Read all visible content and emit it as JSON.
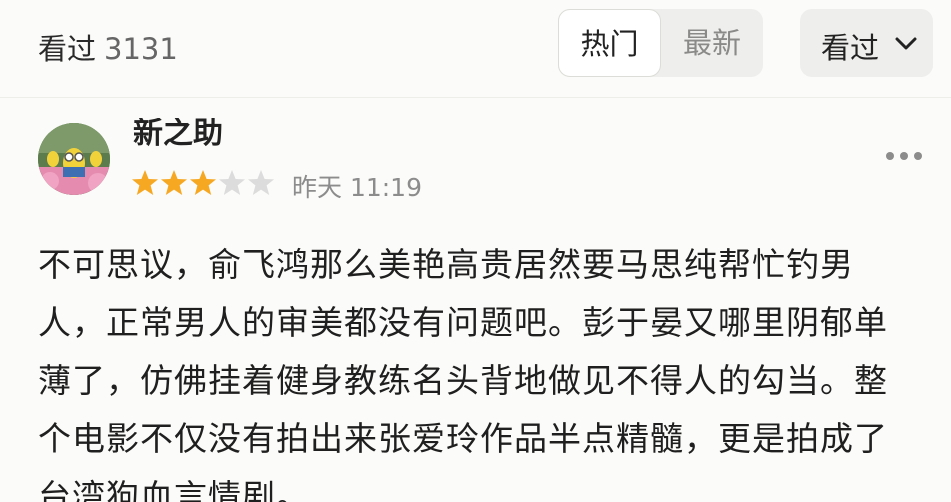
{
  "header": {
    "seen_label": "看过",
    "seen_count": "3131",
    "sort_tabs": [
      "热门",
      "最新"
    ],
    "active_sort": "热门",
    "filter_label": "看过"
  },
  "review": {
    "username": "新之助",
    "rating": 3,
    "rating_max": 5,
    "time": "昨天 11:19",
    "text": "不可思议，俞飞鸿那么美艳高贵居然要马思纯帮忙钓男人，正常男人的审美都没有问题吧。彭于晏又哪里阴郁单薄了，仿佛挂着健身教练名头背地做见不得人的勾当。整个电影不仅没有拍出来张爱玲作品半点精髓，更是拍成了台湾狗血言情剧。"
  },
  "colors": {
    "star_filled": "#f7a823",
    "star_empty": "#dcdcdc",
    "background": "#fbfbf9"
  }
}
